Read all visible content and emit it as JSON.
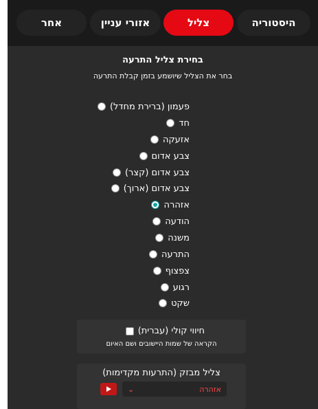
{
  "tabs": [
    {
      "label": "היסטוריה"
    },
    {
      "label": "צליל"
    },
    {
      "label": "אזורי עניין"
    },
    {
      "label": "אחר"
    }
  ],
  "active_tab": "צליל",
  "panel": {
    "title": "בחירת צליל התרעה",
    "subtitle": "בחר את הצליל שיושמע בזמן קבלת התרעה"
  },
  "sound_options": [
    {
      "label": "פעמון (ברירת מחדל)",
      "selected": false
    },
    {
      "label": "חד",
      "selected": false
    },
    {
      "label": "אזעקה",
      "selected": false
    },
    {
      "label": "צבע אדום",
      "selected": false
    },
    {
      "label": "צבע אדום (קצר)",
      "selected": false
    },
    {
      "label": "צבע אדום (ארוך)",
      "selected": false
    },
    {
      "label": "אזהרה",
      "selected": true
    },
    {
      "label": "הודעה",
      "selected": false
    },
    {
      "label": "משנה",
      "selected": false
    },
    {
      "label": "התרעה",
      "selected": false
    },
    {
      "label": "צפצוף",
      "selected": false
    },
    {
      "label": "רגוע",
      "selected": false
    },
    {
      "label": "שקט",
      "selected": false
    }
  ],
  "voice": {
    "label": "חיווי קולי (עברית)",
    "checked": false,
    "description": "הקראה של שמות היישובים ושם האיום"
  },
  "test_sound": {
    "title": "צליל מבזק (התרעות מקדימות)",
    "selected_value": "אזהרה"
  },
  "colors": {
    "accent": "#e50914",
    "background": "#2b2b2b",
    "topbar": "#1a1a1a",
    "radio_checked": "#1aa3a3",
    "select_text": "#ff4a4a"
  },
  "icons": {
    "play": "play-icon",
    "chevron": "chevron-down-icon"
  }
}
